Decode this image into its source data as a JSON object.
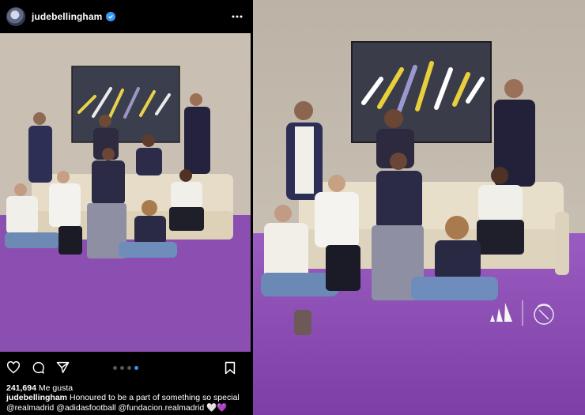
{
  "post": {
    "username": "judebellingham",
    "likes_count": "241,694",
    "likes_label": "Me gusta",
    "caption_user": "judebellingham",
    "caption_text": "Honoured to be a part of something so special",
    "caption_tags": "@realmadrid @adidasfootball @fundacion.realmadrid",
    "caption_emojis": "🤍💜",
    "carousel": {
      "count": 4,
      "active_index": 3
    }
  },
  "icons": {
    "verified": "verified-badge-icon",
    "more": "more-options-icon",
    "like": "heart-icon",
    "comment": "comment-icon",
    "share": "send-icon",
    "save": "bookmark-icon",
    "brand_1": "adidas-logo",
    "brand_2": "real-madrid-crest"
  },
  "colors": {
    "wall": "#c8c0b4",
    "floor": "#8a4fb0",
    "verified_blue": "#3897f0",
    "sofa": "#e7ddc8"
  }
}
